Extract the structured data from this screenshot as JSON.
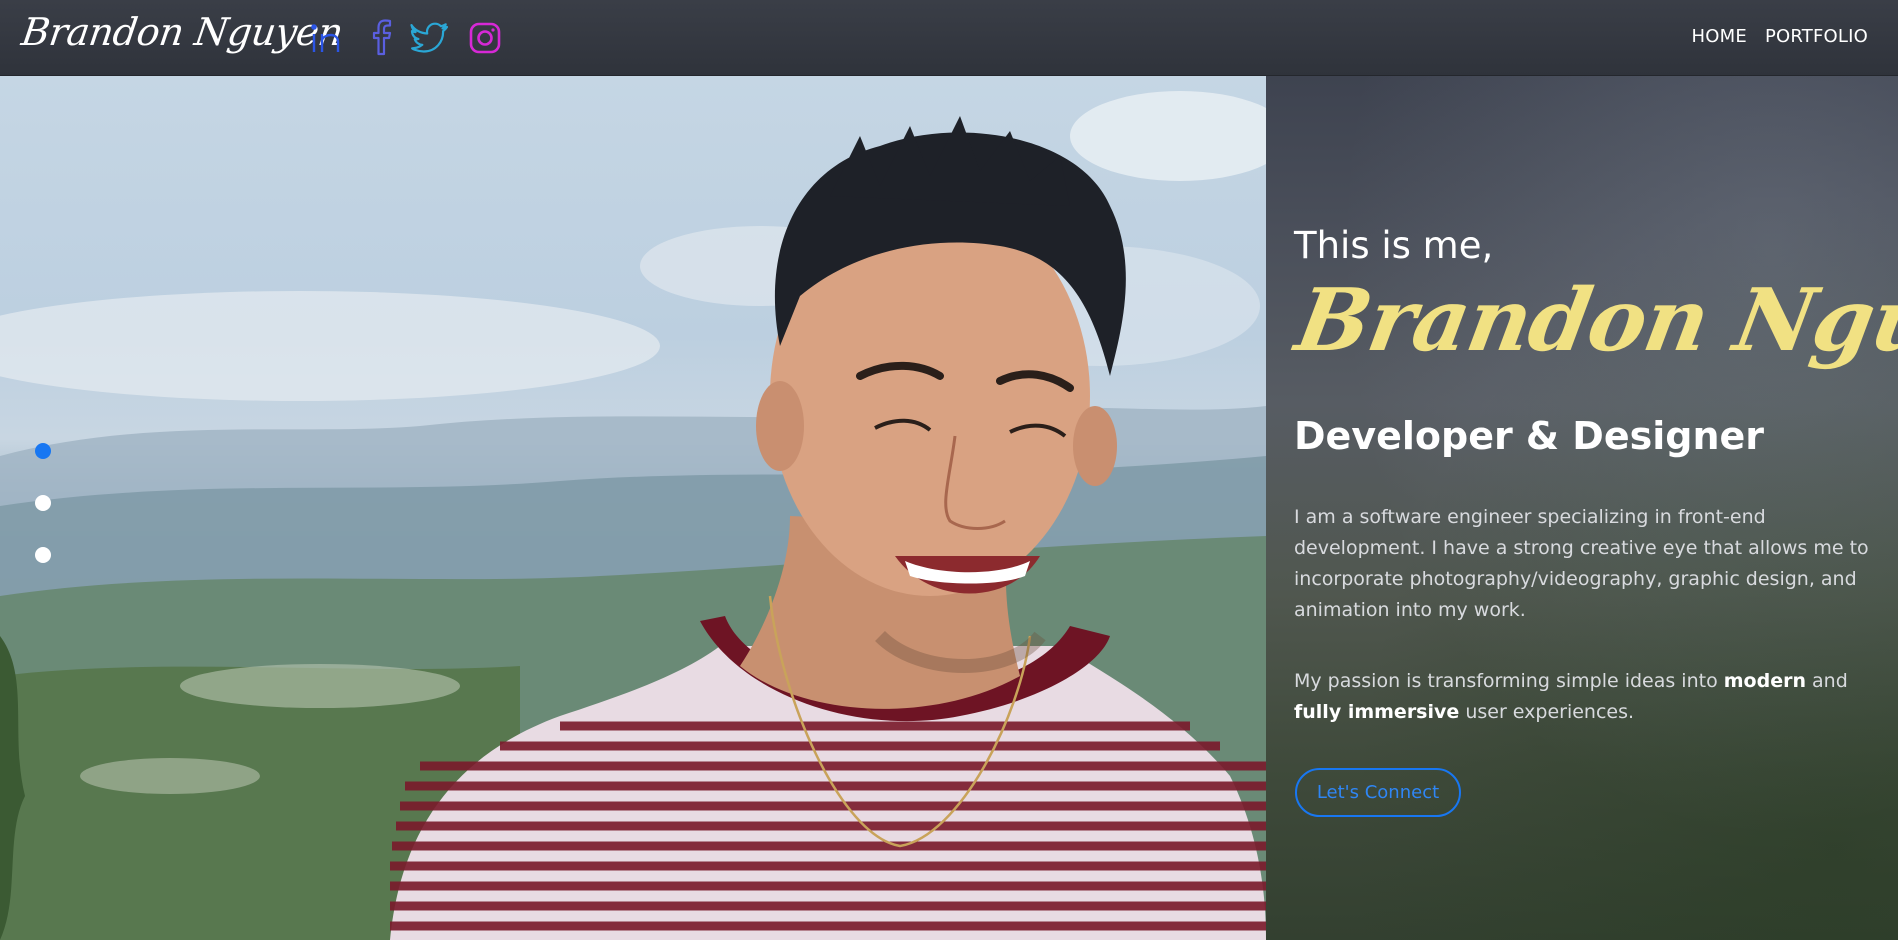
{
  "navbar": {
    "brand": "Brandon Nguyen",
    "social": [
      {
        "icon": "linkedin-icon",
        "color": "#2b55e6"
      },
      {
        "icon": "facebook-icon",
        "color": "#5a5fe0"
      },
      {
        "icon": "twitter-icon",
        "color": "#2aa7d6"
      },
      {
        "icon": "instagram-icon",
        "color": "#d629d6"
      }
    ],
    "links": [
      "HOME",
      "PORTFOLIO"
    ]
  },
  "hero": {
    "greeting": "This is me,",
    "name": "Brandon Nguyen",
    "role": "Developer & Designer",
    "bio": "I am a software engineer specializing in front-end development. I have a strong creative eye that allows me to incorporate photography/videography, graphic design, and animation into my work.",
    "passion": {
      "part1": "My passion is transforming simple ideas into ",
      "bold1": "modern",
      "part2": " and ",
      "bold2": "fully immersive",
      "part3": " user experiences."
    },
    "cta_label": "Let's Connect",
    "name_color": "#f1e183",
    "accent": "#1877f2"
  },
  "carousel": {
    "slides": 3,
    "active_index": 0
  }
}
